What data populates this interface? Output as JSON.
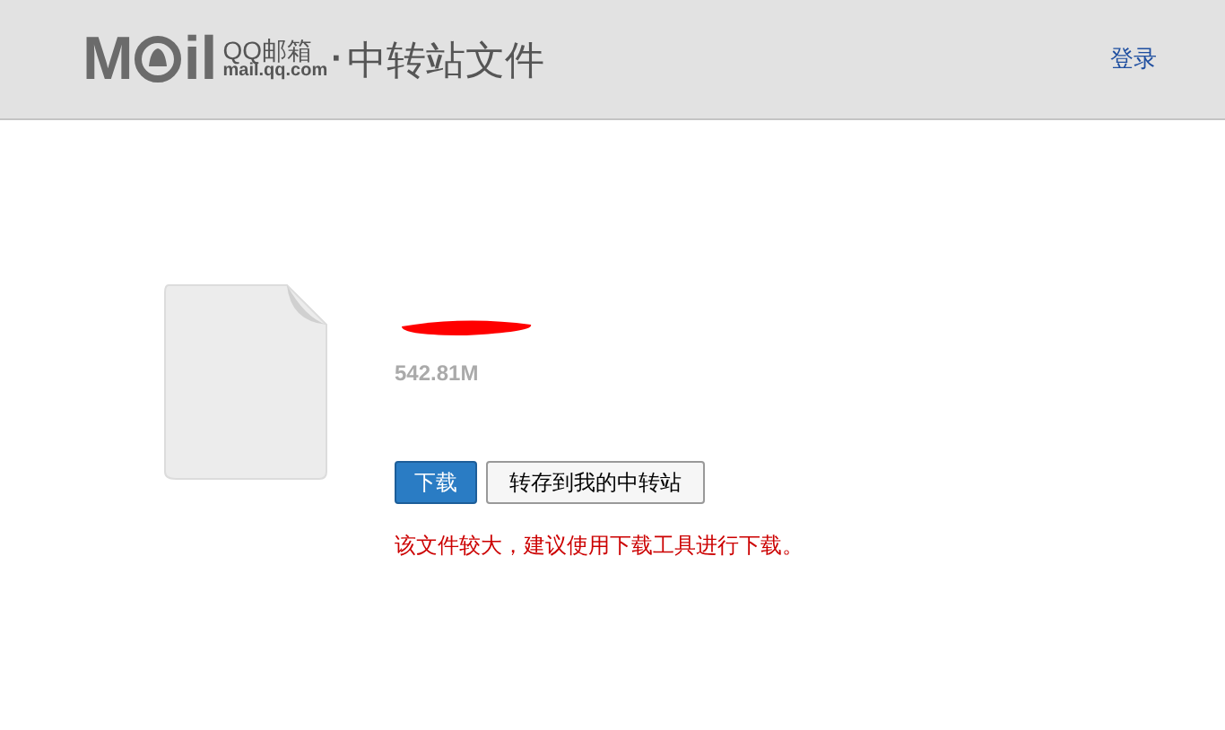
{
  "header": {
    "logo_start": "M",
    "logo_end": "il",
    "brand": "QQ邮箱",
    "domain": "mail.qq.com",
    "separator": "·",
    "title": "中转站文件",
    "login": "登录"
  },
  "file": {
    "size": "542.81M",
    "name_redacted": true
  },
  "buttons": [
    {
      "label": "下载",
      "kind": "primary"
    },
    {
      "label": "转存到我的中转站",
      "kind": "secondary"
    }
  ],
  "notice": "该文件较大，建议使用下载工具进行下载。"
}
